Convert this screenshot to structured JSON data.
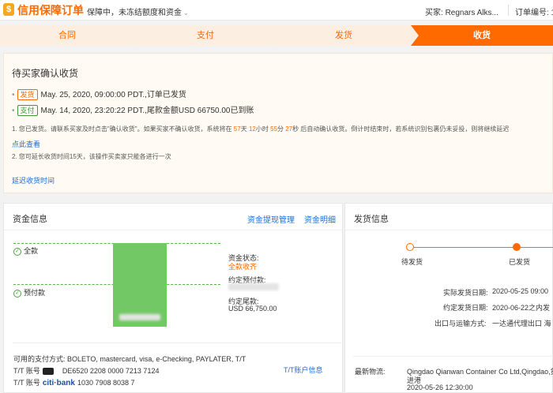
{
  "header": {
    "brand_icon": "$",
    "brand_title": "信用保障订单",
    "brand_subtitle": "保障中，未冻结额度和资金",
    "chevron": "⌄",
    "buyer_label": "买家:",
    "buyer_name": "Regnars Alks...",
    "order_label": "订单编号: 1"
  },
  "steps": [
    {
      "label": "合同",
      "state": "done"
    },
    {
      "label": "支付",
      "state": "done"
    },
    {
      "label": "发货",
      "state": "done"
    },
    {
      "label": "收货",
      "state": "active"
    }
  ],
  "confirm": {
    "title": "待买家确认收货",
    "events": [
      {
        "tag": "发货",
        "text": "May. 25, 2020, 09:00:00 PDT.,订单已发货"
      },
      {
        "tag": "支付",
        "text": "May. 14, 2020, 23:20:22 PDT.,尾款金额USD 66750.00已到账"
      }
    ],
    "note1_a": "1. 您已发货。请联系买家及时点击\"确认收货\"。如果买家不确认收货，系统将在 ",
    "countdown_days": "57",
    "unit_days": "天 ",
    "countdown_hours": "12",
    "unit_hours": "小时 ",
    "countdown_minutes": "55",
    "unit_minutes": "分 ",
    "countdown_seconds": "27",
    "note1_b": "秒 后自动确认收货。倒计时结束时，若系统识别包裹仍未妥投，则将继续延迟",
    "see_more": "点此查看",
    "note2": "2. 您可延长收货时间15天，该操作买卖家只能各进行一次",
    "extend_link": "延迟收货时间"
  },
  "fund": {
    "title": "资金信息",
    "link_withdraw": "资金提现管理",
    "link_detail": "资金明细",
    "check_icon": "✓",
    "label_full": "全款",
    "label_prepay": "预付款",
    "status_label": "资金状态:",
    "status_value": "全款收齐",
    "prepay_label": "约定预付款:",
    "balance_label": "约定尾款:",
    "balance_value": "USD 66,750.00",
    "payment_methods": "可用的支付方式: BOLETO, mastercard, visa, e-Checking, PAYLATER, T/T",
    "tt_label": "T/T 账号",
    "tt_account_1": "DE6520 2208 0000 7213 7124",
    "citi_a": "citi",
    "citi_b": "bank",
    "citi_dot": "·",
    "tt_account_2": "1030 7908 8038 7",
    "tt_link": "T/T账户信息"
  },
  "shipping": {
    "title": "发货信息",
    "track": [
      {
        "label": "待发货"
      },
      {
        "label": "已发货"
      }
    ],
    "actual_label": "实际发货日期:",
    "actual_value": "2020-05-25 09:00",
    "agreed_label": "约定发货日期:",
    "agreed_value": "2020-06-22之内发",
    "port_label": "出口与运输方式:",
    "port_value": "一达通代理出口 海",
    "logistics_label": "最新物流:",
    "logistics_value": "Qingdao Qianwan Container Co Ltd,Qingdao,货",
    "logistics_value2": "进港",
    "logistics_time": "2020-05-26 12:30:00"
  }
}
